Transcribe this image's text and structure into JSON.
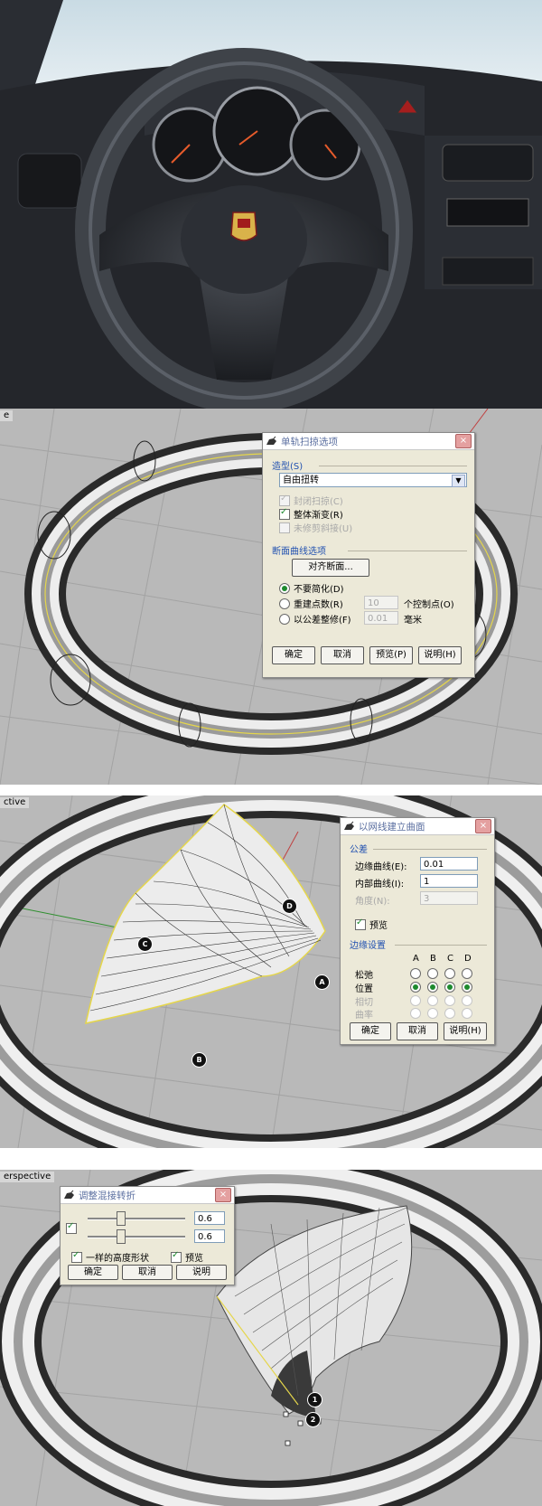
{
  "viewport1": {
    "label": "e"
  },
  "sweep_dialog": {
    "title": "单轨扫掠选项",
    "close": "×",
    "style_group": "造型(S)",
    "style_value": "自由扭转",
    "opt_closed": "封闭扫掠(C)",
    "opt_global_blend": "整体渐变(R)",
    "opt_untrimmed": "未修剪斜接(U)",
    "section_group": "断面曲线选项",
    "align_button": "对齐断面...",
    "radio_no_simplify": "不要简化(D)",
    "radio_rebuild": "重建点数(R)",
    "rebuild_value": "10",
    "rebuild_unit": "个控制点(O)",
    "radio_refit": "以公差整修(F)",
    "refit_value": "0.01",
    "refit_unit": "毫米",
    "ok": "确定",
    "cancel": "取消",
    "preview": "预览(P)",
    "help": "说明(H)"
  },
  "viewport2": {
    "label": "ctive"
  },
  "network_dialog": {
    "title": "以网线建立曲面",
    "close": "×",
    "tolerance_group": "公差",
    "edge_curves_label": "边缘曲线(E):",
    "edge_curves_value": "0.01",
    "inner_curves_label": "内部曲线(I):",
    "inner_curves_value": "1",
    "angle_label": "角度(N):",
    "angle_value": "3",
    "preview_label": "预览",
    "edge_group": "边缘设置",
    "col_headers": [
      "A",
      "B",
      "C",
      "D"
    ],
    "row_loose": "松弛",
    "row_position": "位置",
    "row_tangent": "相切",
    "row_curvature": "曲率",
    "ok": "确定",
    "cancel": "取消",
    "help": "说明(H)"
  },
  "markers": {
    "a": "A",
    "b": "B",
    "c": "C",
    "d": "D",
    "one": "1",
    "two": "2"
  },
  "viewport3": {
    "label": "erspective"
  },
  "twist_dialog": {
    "title": "调整混接转折",
    "close": "×",
    "value1": "0.6",
    "value2": "0.6",
    "same_height": "一样的高度形状",
    "preview": "预览",
    "ok": "确定",
    "cancel": "取消",
    "help": "说明"
  },
  "colors": {
    "dialog_bg": "#ece9d8",
    "group_text": "#2050b0",
    "viewport_bg": "#b9b9b9",
    "check_green": "#1d8a2e"
  }
}
